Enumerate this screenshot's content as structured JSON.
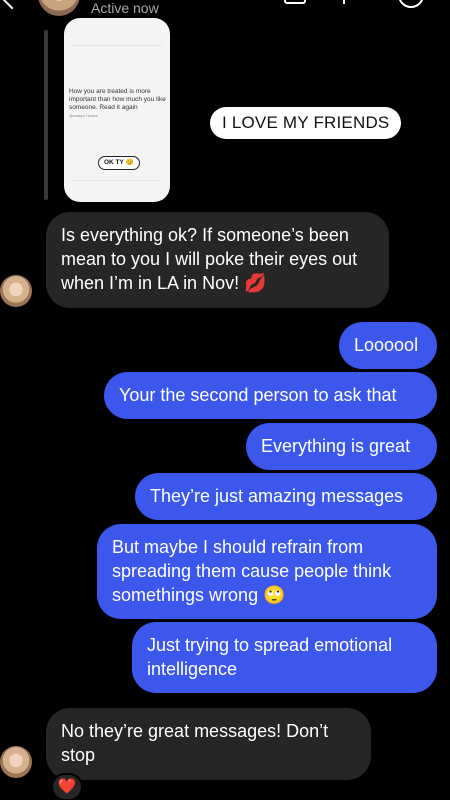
{
  "header": {
    "status": "Active now"
  },
  "story": {
    "text": "How you are treated is more important than how much you like someone. Read it again",
    "handle": "@modupe.f.peace",
    "button": "OK TY 😊"
  },
  "sticker": {
    "text": "I LOVE MY FRIENDS"
  },
  "messages": [
    {
      "direction": "received",
      "text": "Is everything ok? If someone’s been mean to you I will poke their eyes out when I’m in LA in Nov! 💋"
    },
    {
      "direction": "sent",
      "text": "Loooool"
    },
    {
      "direction": "sent",
      "text": "Your the second person to ask that"
    },
    {
      "direction": "sent",
      "text": "Everything is great"
    },
    {
      "direction": "sent",
      "text": "They’re just amazing messages"
    },
    {
      "direction": "sent",
      "text": "But maybe I should refrain from spreading them cause people think somethings wrong 🙄"
    },
    {
      "direction": "sent",
      "text": "Just trying to spread emotional intelligence"
    },
    {
      "direction": "received",
      "text": "No they’re great messages! Don’t stop"
    }
  ],
  "reaction": "❤️",
  "colors": {
    "background": "#000000",
    "received_bubble": "#262626",
    "sent_bubble": "#3b57ec"
  },
  "icons": [
    "back-chevron-icon",
    "video-call-icon",
    "phone-icon",
    "info-icon",
    "heart-reaction-icon"
  ]
}
